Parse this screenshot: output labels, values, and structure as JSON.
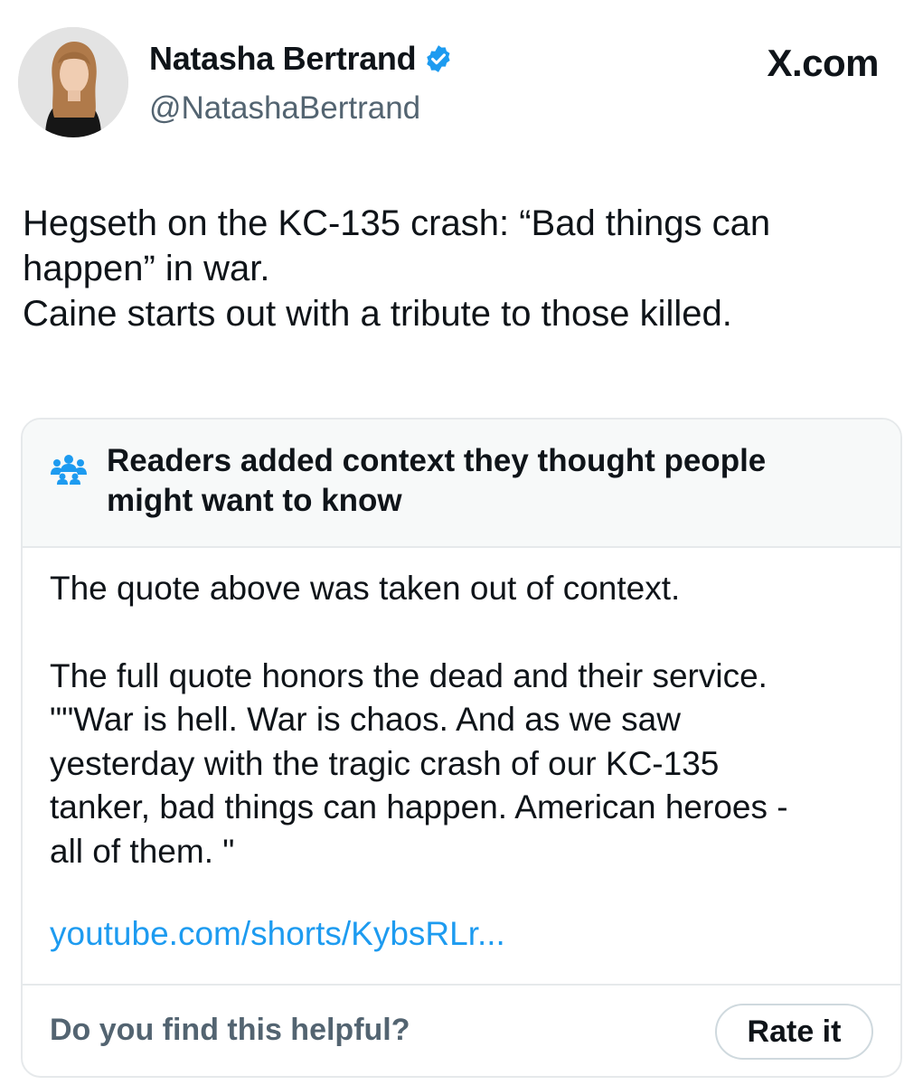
{
  "author": {
    "name": "Natasha Bertrand",
    "handle": "@NatashaBertrand",
    "verified_badge_icon": "verified-badge-icon",
    "badge_color": "#1d9bf0"
  },
  "site_label": "X.com",
  "tweet": {
    "lines": [
      "Hegseth on the KC-135 crash: “Bad things can",
      "happen” in war.",
      "Caine starts out with a tribute to those killed."
    ]
  },
  "community_note": {
    "icon": "people-icon",
    "header_lines": [
      "Readers added context they thought people",
      "might want to know"
    ],
    "body_first": "The quote above was taken out of context.",
    "body_lines": [
      "The full quote honors the dead and their service.",
      "\"\"War is hell. War is chaos. And as we saw",
      "yesterday with the tragic crash of our KC-135",
      "tanker, bad things can happen. American heroes -",
      "all of them. \""
    ],
    "link": "youtube.com/shorts/KybsRLr...",
    "link_color": "#1d9bf0",
    "footer_question": "Do you find this helpful?",
    "rate_button": "Rate it"
  }
}
